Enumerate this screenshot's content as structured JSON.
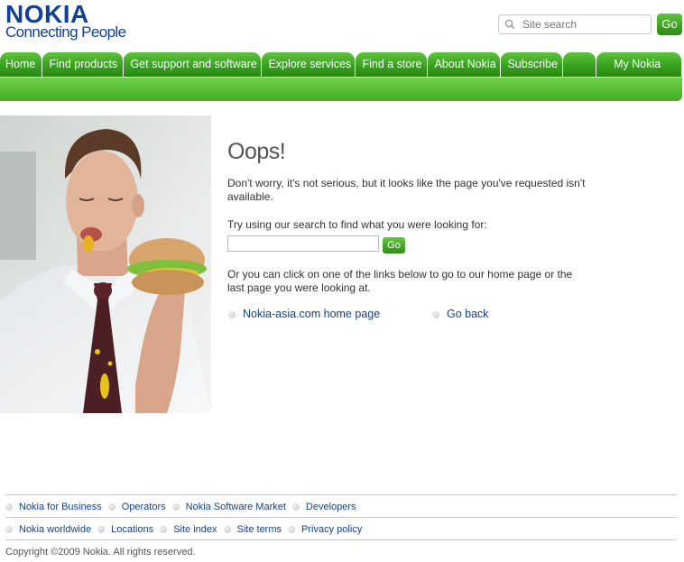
{
  "brand": {
    "logo": "NOKIA",
    "tagline": "Connecting People"
  },
  "header_search": {
    "placeholder": "Site search",
    "go_label": "Go"
  },
  "nav": {
    "items": [
      "Home",
      "Find products",
      "Get support and software",
      "Explore services",
      "Find a store",
      "About Nokia",
      "Subscribe",
      "",
      "My Nokia"
    ]
  },
  "content": {
    "title": "Oops!",
    "para1": "Don't worry, it's not serious, but it looks like the page you've requested isn't available.",
    "para2": "Try using our search to find what you were looking for:",
    "search_value": "",
    "go_label": "Go",
    "para3": "Or you can click on one of the links below to go to our home page or the last page you were looking at.",
    "link_home": "Nokia-asia.com home page",
    "link_back": "Go back"
  },
  "footer": {
    "row1": [
      "Nokia for Business",
      "Operators",
      "Nokia Software Market",
      "Developers"
    ],
    "row2": [
      "Nokia worldwide",
      "Locations",
      "Site index",
      "Site terms",
      "Privacy policy"
    ],
    "copyright": "Copyright ©2009 Nokia. All rights reserved."
  },
  "colors": {
    "brand_blue": "#124191",
    "nav_green": "#38a21f"
  },
  "icons": {
    "search": "magnifier-icon",
    "bullet": "grey-bullet-icon"
  }
}
